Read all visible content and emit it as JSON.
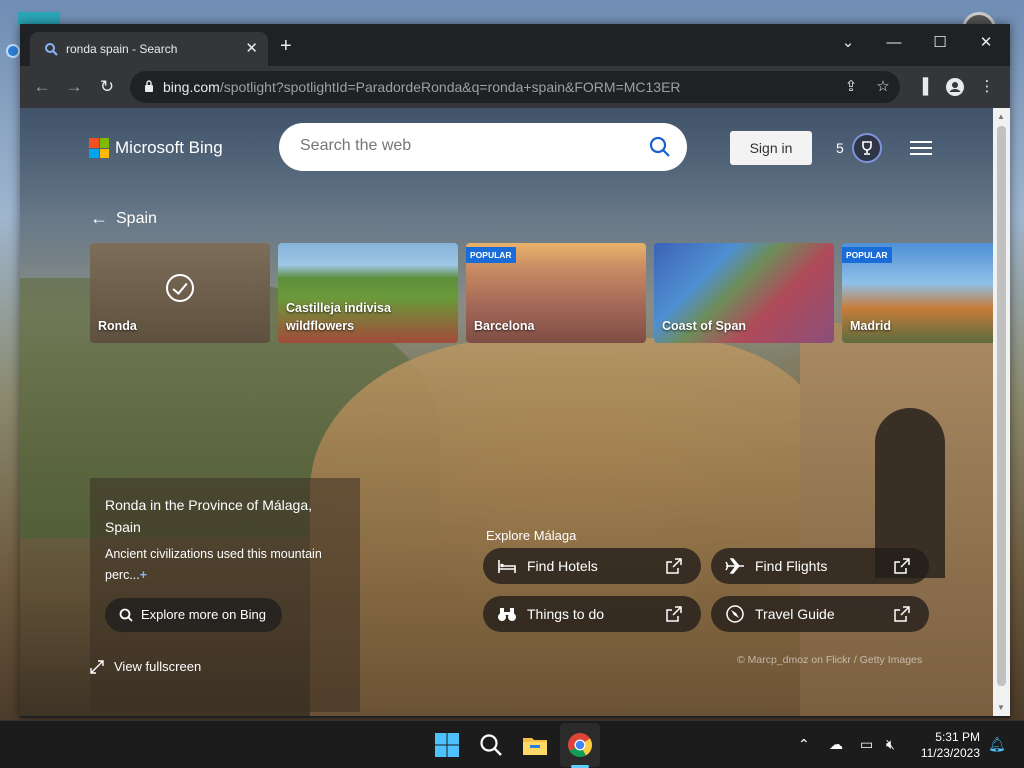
{
  "browser": {
    "tab_title": "ronda spain - Search",
    "url_host": "bing.com",
    "url_path": "/spotlight?spotlightId=ParadordeRonda&q=ronda+spain&FORM=MC13ER"
  },
  "bing": {
    "brand": "Microsoft Bing",
    "search_placeholder": "Search the web",
    "sign_in": "Sign in",
    "points": "5",
    "back_label": "Spain"
  },
  "carousel": [
    {
      "label": "Ronda",
      "badge": "",
      "selected": true
    },
    {
      "label": "Castilleja indivisa wildflowers",
      "badge": "",
      "selected": false
    },
    {
      "label": "Barcelona",
      "badge": "POPULAR",
      "selected": false
    },
    {
      "label": "Coast of Span",
      "badge": "",
      "selected": false
    },
    {
      "label": "Madrid",
      "badge": "POPULAR",
      "selected": false
    }
  ],
  "info": {
    "title": "Ronda in the Province of Málaga, Spain",
    "description": "Ancient civilizations used this mountain perc...",
    "expand": "+",
    "explore_more": "Explore more on Bing",
    "fullscreen": "View fullscreen"
  },
  "explore": {
    "label": "Explore Málaga",
    "chips": [
      {
        "label": "Find Hotels",
        "icon": "bed-icon"
      },
      {
        "label": "Find Flights",
        "icon": "airplane-icon"
      },
      {
        "label": "Things to do",
        "icon": "binoculars-icon"
      },
      {
        "label": "Travel Guide",
        "icon": "compass-icon"
      }
    ]
  },
  "credit": "© Marcp_dmoz on Flickr / Getty Images",
  "taskbar": {
    "time": "5:31 PM",
    "date": "11/23/2023"
  }
}
